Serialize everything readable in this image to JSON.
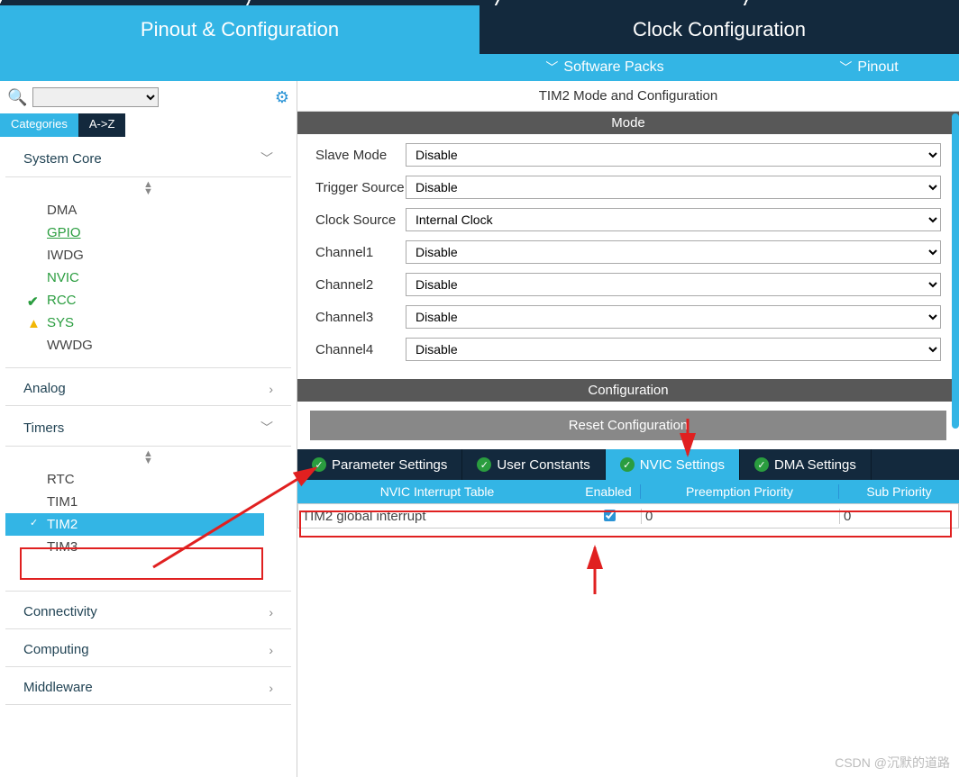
{
  "top_tabs": {
    "pinout": "Pinout & Configuration",
    "clock": "Clock Configuration"
  },
  "sub_bar": {
    "software_packs": "Software Packs",
    "pinout": "Pinout"
  },
  "cat_tabs": {
    "categories": "Categories",
    "az": "A->Z"
  },
  "groups": {
    "system_core": "System Core",
    "analog": "Analog",
    "timers": "Timers",
    "connectivity": "Connectivity",
    "computing": "Computing",
    "middleware": "Middleware"
  },
  "system_core_items": [
    "DMA",
    "GPIO",
    "IWDG",
    "NVIC",
    "RCC",
    "SYS",
    "WWDG"
  ],
  "timers_items": [
    "RTC",
    "TIM1",
    "TIM2",
    "TIM3"
  ],
  "panel": {
    "title": "TIM2 Mode and Configuration",
    "mode": "Mode",
    "configuration": "Configuration",
    "reset": "Reset Configuration"
  },
  "mode_rows": [
    {
      "label": "Slave Mode",
      "value": "Disable"
    },
    {
      "label": "Trigger Source",
      "value": "Disable"
    },
    {
      "label": "Clock Source",
      "value": "Internal Clock"
    },
    {
      "label": "Channel1",
      "value": "Disable"
    },
    {
      "label": "Channel2",
      "value": "Disable"
    },
    {
      "label": "Channel3",
      "value": "Disable"
    },
    {
      "label": "Channel4",
      "value": "Disable"
    }
  ],
  "cfg_tabs": {
    "param": "Parameter Settings",
    "user": "User Constants",
    "nvic": "NVIC Settings",
    "dma": "DMA Settings"
  },
  "nvic_header": {
    "table": "NVIC Interrupt Table",
    "enabled": "Enabled",
    "preempt": "Preemption Priority",
    "sub": "Sub Priority"
  },
  "nvic_row": {
    "name": "TIM2 global interrupt",
    "preempt": "0",
    "sub": "0"
  },
  "watermark": "CSDN @沉默的道路"
}
